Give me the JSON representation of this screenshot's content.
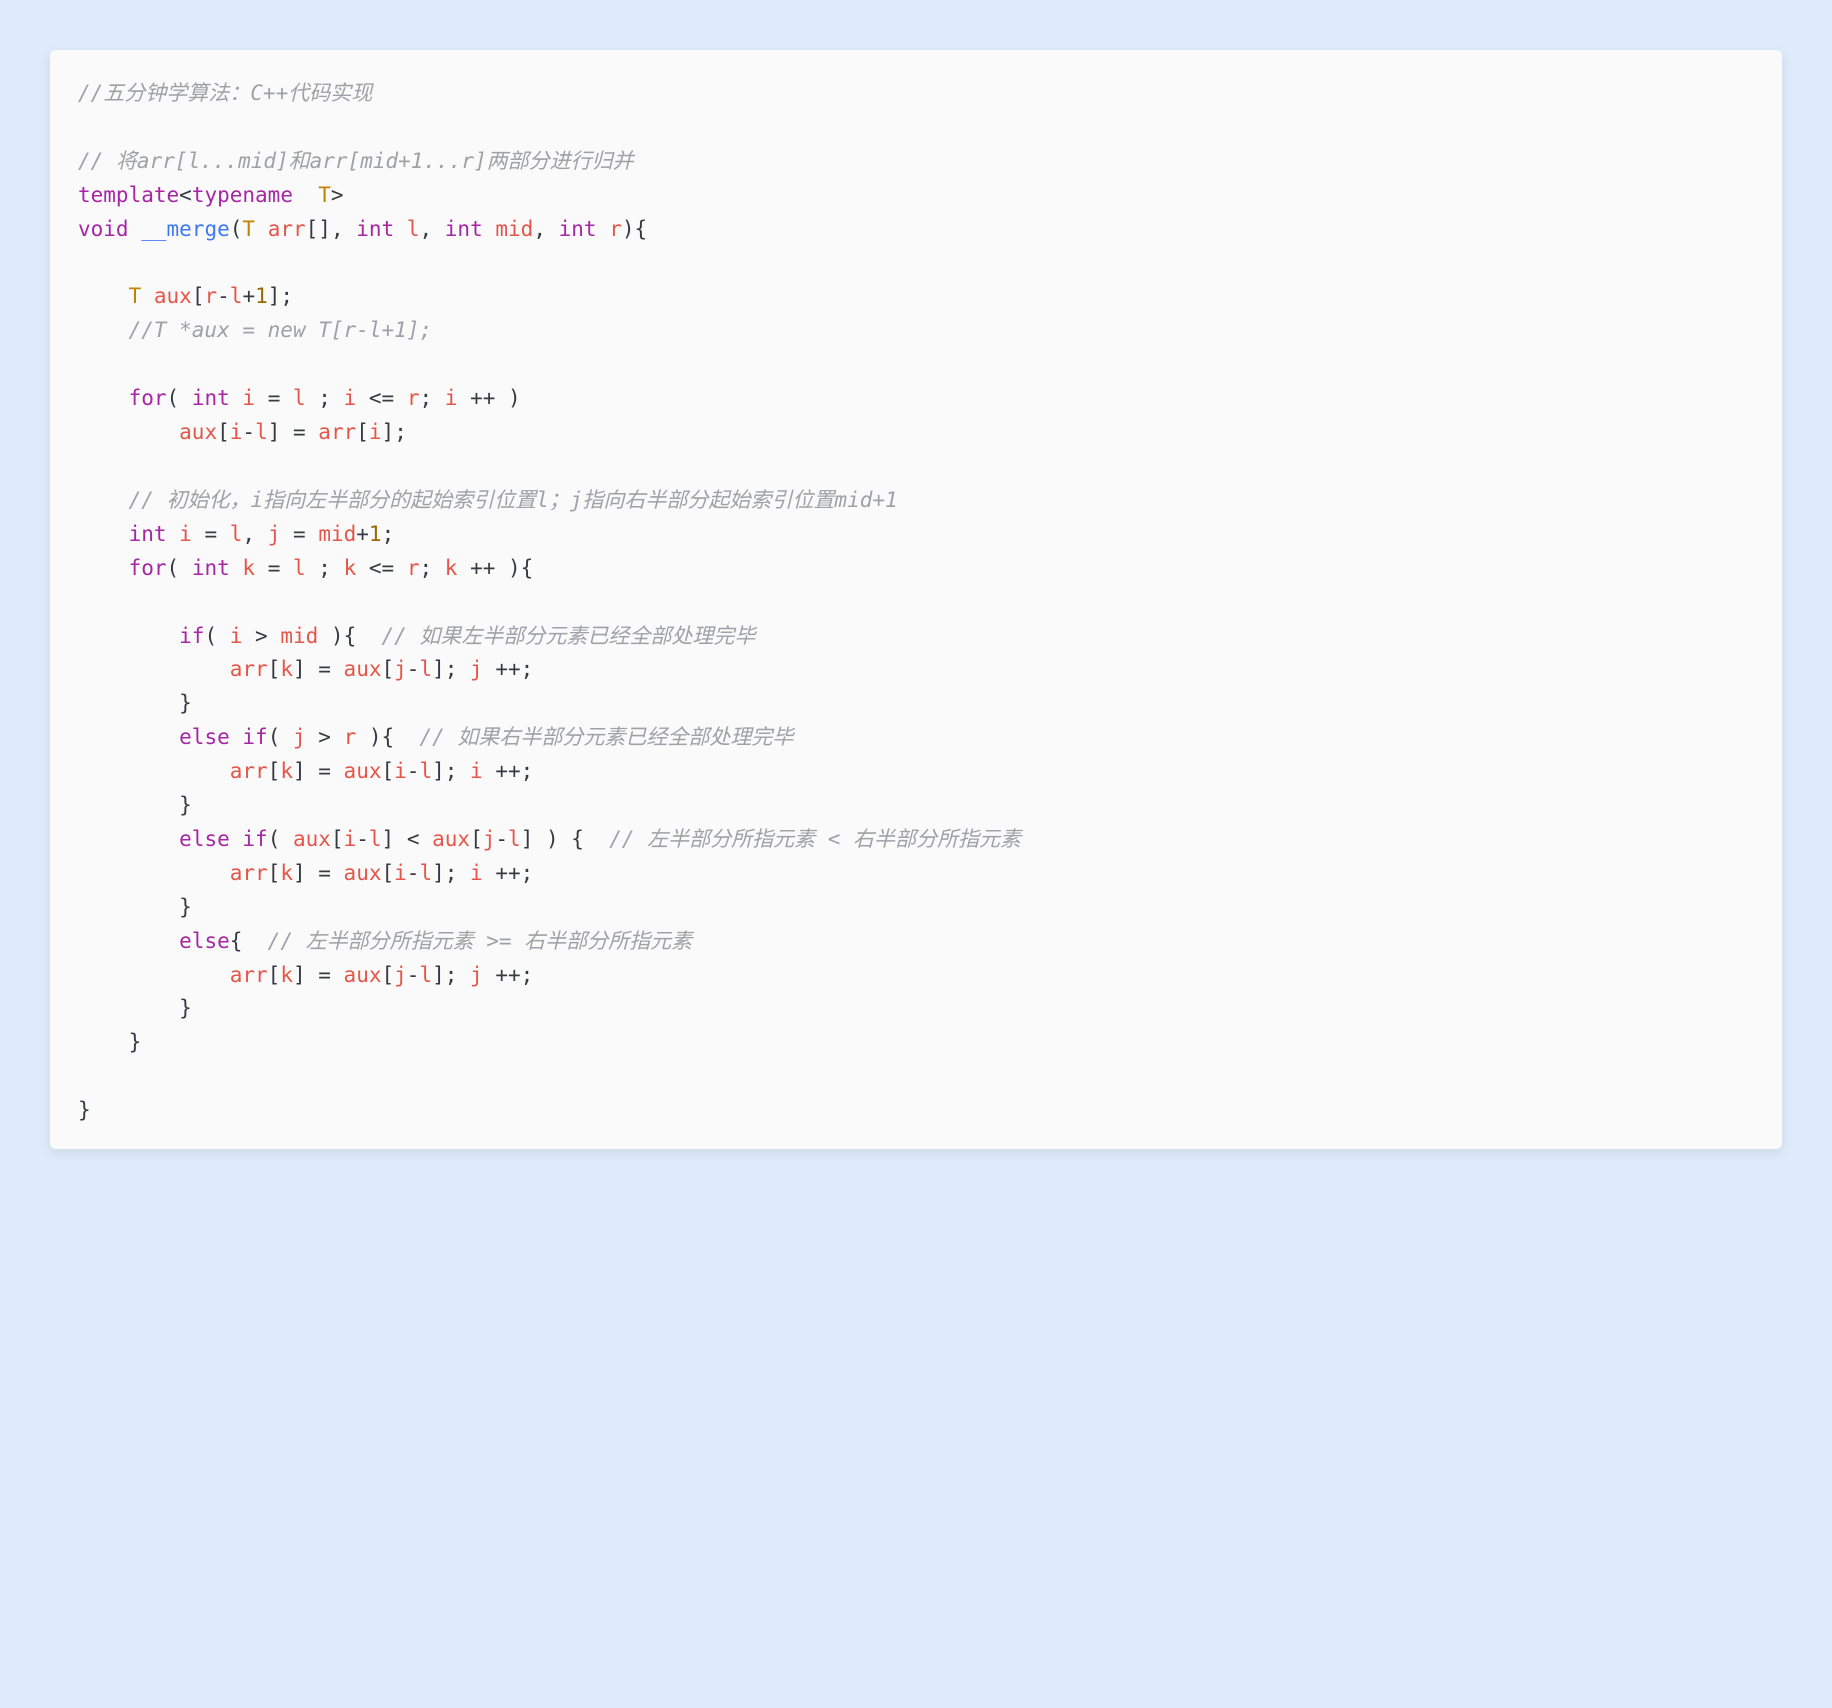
{
  "code": {
    "tokens": [
      [
        {
          "t": "//五分钟学算法：C++代码实现",
          "cls": "c"
        }
      ],
      [],
      [
        {
          "t": "// 将arr[l...mid]和arr[mid+1...r]两部分进行归并",
          "cls": "c"
        }
      ],
      [
        {
          "t": "template",
          "cls": "kw"
        },
        {
          "t": "<",
          "cls": "op"
        },
        {
          "t": "typename",
          "cls": "kw"
        },
        {
          "t": "  ",
          "cls": "pl"
        },
        {
          "t": "T",
          "cls": "ty"
        },
        {
          "t": ">",
          "cls": "op"
        }
      ],
      [
        {
          "t": "void",
          "cls": "kw"
        },
        {
          "t": " ",
          "cls": "pl"
        },
        {
          "t": "__merge",
          "cls": "fn"
        },
        {
          "t": "(",
          "cls": "pl"
        },
        {
          "t": "T",
          "cls": "ty"
        },
        {
          "t": " ",
          "cls": "pl"
        },
        {
          "t": "arr",
          "cls": "vr"
        },
        {
          "t": "[], ",
          "cls": "pl"
        },
        {
          "t": "int",
          "cls": "kw"
        },
        {
          "t": " ",
          "cls": "pl"
        },
        {
          "t": "l",
          "cls": "vr"
        },
        {
          "t": ", ",
          "cls": "pl"
        },
        {
          "t": "int",
          "cls": "kw"
        },
        {
          "t": " ",
          "cls": "pl"
        },
        {
          "t": "mid",
          "cls": "vr"
        },
        {
          "t": ", ",
          "cls": "pl"
        },
        {
          "t": "int",
          "cls": "kw"
        },
        {
          "t": " ",
          "cls": "pl"
        },
        {
          "t": "r",
          "cls": "vr"
        },
        {
          "t": "){",
          "cls": "pl"
        }
      ],
      [],
      [
        {
          "t": "    ",
          "cls": "pl"
        },
        {
          "t": "T",
          "cls": "ty"
        },
        {
          "t": " ",
          "cls": "pl"
        },
        {
          "t": "aux",
          "cls": "vr"
        },
        {
          "t": "[",
          "cls": "pl"
        },
        {
          "t": "r",
          "cls": "vr"
        },
        {
          "t": "-",
          "cls": "op"
        },
        {
          "t": "l",
          "cls": "vr"
        },
        {
          "t": "+",
          "cls": "op"
        },
        {
          "t": "1",
          "cls": "nm"
        },
        {
          "t": "];",
          "cls": "pl"
        }
      ],
      [
        {
          "t": "    ",
          "cls": "pl"
        },
        {
          "t": "//T *aux = new T[r-l+1];",
          "cls": "c"
        }
      ],
      [],
      [
        {
          "t": "    ",
          "cls": "pl"
        },
        {
          "t": "for",
          "cls": "kw"
        },
        {
          "t": "( ",
          "cls": "pl"
        },
        {
          "t": "int",
          "cls": "kw"
        },
        {
          "t": " ",
          "cls": "pl"
        },
        {
          "t": "i",
          "cls": "vr"
        },
        {
          "t": " = ",
          "cls": "op"
        },
        {
          "t": "l",
          "cls": "vr"
        },
        {
          "t": " ; ",
          "cls": "pl"
        },
        {
          "t": "i",
          "cls": "vr"
        },
        {
          "t": " <= ",
          "cls": "op"
        },
        {
          "t": "r",
          "cls": "vr"
        },
        {
          "t": "; ",
          "cls": "pl"
        },
        {
          "t": "i",
          "cls": "vr"
        },
        {
          "t": " ++ )",
          "cls": "pl"
        }
      ],
      [
        {
          "t": "        ",
          "cls": "pl"
        },
        {
          "t": "aux",
          "cls": "vr"
        },
        {
          "t": "[",
          "cls": "pl"
        },
        {
          "t": "i",
          "cls": "vr"
        },
        {
          "t": "-",
          "cls": "op"
        },
        {
          "t": "l",
          "cls": "vr"
        },
        {
          "t": "] = ",
          "cls": "pl"
        },
        {
          "t": "arr",
          "cls": "vr"
        },
        {
          "t": "[",
          "cls": "pl"
        },
        {
          "t": "i",
          "cls": "vr"
        },
        {
          "t": "];",
          "cls": "pl"
        }
      ],
      [],
      [
        {
          "t": "    ",
          "cls": "pl"
        },
        {
          "t": "// 初始化，i指向左半部分的起始索引位置l；j指向右半部分起始索引位置mid+1",
          "cls": "c"
        }
      ],
      [
        {
          "t": "    ",
          "cls": "pl"
        },
        {
          "t": "int",
          "cls": "kw"
        },
        {
          "t": " ",
          "cls": "pl"
        },
        {
          "t": "i",
          "cls": "vr"
        },
        {
          "t": " = ",
          "cls": "op"
        },
        {
          "t": "l",
          "cls": "vr"
        },
        {
          "t": ", ",
          "cls": "pl"
        },
        {
          "t": "j",
          "cls": "vr"
        },
        {
          "t": " = ",
          "cls": "op"
        },
        {
          "t": "mid",
          "cls": "vr"
        },
        {
          "t": "+",
          "cls": "op"
        },
        {
          "t": "1",
          "cls": "nm"
        },
        {
          "t": ";",
          "cls": "pl"
        }
      ],
      [
        {
          "t": "    ",
          "cls": "pl"
        },
        {
          "t": "for",
          "cls": "kw"
        },
        {
          "t": "( ",
          "cls": "pl"
        },
        {
          "t": "int",
          "cls": "kw"
        },
        {
          "t": " ",
          "cls": "pl"
        },
        {
          "t": "k",
          "cls": "vr"
        },
        {
          "t": " = ",
          "cls": "op"
        },
        {
          "t": "l",
          "cls": "vr"
        },
        {
          "t": " ; ",
          "cls": "pl"
        },
        {
          "t": "k",
          "cls": "vr"
        },
        {
          "t": " <= ",
          "cls": "op"
        },
        {
          "t": "r",
          "cls": "vr"
        },
        {
          "t": "; ",
          "cls": "pl"
        },
        {
          "t": "k",
          "cls": "vr"
        },
        {
          "t": " ++ ){",
          "cls": "pl"
        }
      ],
      [],
      [
        {
          "t": "        ",
          "cls": "pl"
        },
        {
          "t": "if",
          "cls": "kw"
        },
        {
          "t": "( ",
          "cls": "pl"
        },
        {
          "t": "i",
          "cls": "vr"
        },
        {
          "t": " > ",
          "cls": "op"
        },
        {
          "t": "mid",
          "cls": "vr"
        },
        {
          "t": " ){  ",
          "cls": "pl"
        },
        {
          "t": "// 如果左半部分元素已经全部处理完毕",
          "cls": "c"
        }
      ],
      [
        {
          "t": "            ",
          "cls": "pl"
        },
        {
          "t": "arr",
          "cls": "vr"
        },
        {
          "t": "[",
          "cls": "pl"
        },
        {
          "t": "k",
          "cls": "vr"
        },
        {
          "t": "] = ",
          "cls": "pl"
        },
        {
          "t": "aux",
          "cls": "vr"
        },
        {
          "t": "[",
          "cls": "pl"
        },
        {
          "t": "j",
          "cls": "vr"
        },
        {
          "t": "-",
          "cls": "op"
        },
        {
          "t": "l",
          "cls": "vr"
        },
        {
          "t": "]; ",
          "cls": "pl"
        },
        {
          "t": "j",
          "cls": "vr"
        },
        {
          "t": " ++;",
          "cls": "pl"
        }
      ],
      [
        {
          "t": "        }",
          "cls": "pl"
        }
      ],
      [
        {
          "t": "        ",
          "cls": "pl"
        },
        {
          "t": "else",
          "cls": "kw"
        },
        {
          "t": " ",
          "cls": "pl"
        },
        {
          "t": "if",
          "cls": "kw"
        },
        {
          "t": "( ",
          "cls": "pl"
        },
        {
          "t": "j",
          "cls": "vr"
        },
        {
          "t": " > ",
          "cls": "op"
        },
        {
          "t": "r",
          "cls": "vr"
        },
        {
          "t": " ){  ",
          "cls": "pl"
        },
        {
          "t": "// 如果右半部分元素已经全部处理完毕",
          "cls": "c"
        }
      ],
      [
        {
          "t": "            ",
          "cls": "pl"
        },
        {
          "t": "arr",
          "cls": "vr"
        },
        {
          "t": "[",
          "cls": "pl"
        },
        {
          "t": "k",
          "cls": "vr"
        },
        {
          "t": "] = ",
          "cls": "pl"
        },
        {
          "t": "aux",
          "cls": "vr"
        },
        {
          "t": "[",
          "cls": "pl"
        },
        {
          "t": "i",
          "cls": "vr"
        },
        {
          "t": "-",
          "cls": "op"
        },
        {
          "t": "l",
          "cls": "vr"
        },
        {
          "t": "]; ",
          "cls": "pl"
        },
        {
          "t": "i",
          "cls": "vr"
        },
        {
          "t": " ++;",
          "cls": "pl"
        }
      ],
      [
        {
          "t": "        }",
          "cls": "pl"
        }
      ],
      [
        {
          "t": "        ",
          "cls": "pl"
        },
        {
          "t": "else",
          "cls": "kw"
        },
        {
          "t": " ",
          "cls": "pl"
        },
        {
          "t": "if",
          "cls": "kw"
        },
        {
          "t": "( ",
          "cls": "pl"
        },
        {
          "t": "aux",
          "cls": "vr"
        },
        {
          "t": "[",
          "cls": "pl"
        },
        {
          "t": "i",
          "cls": "vr"
        },
        {
          "t": "-",
          "cls": "op"
        },
        {
          "t": "l",
          "cls": "vr"
        },
        {
          "t": "] < ",
          "cls": "pl"
        },
        {
          "t": "aux",
          "cls": "vr"
        },
        {
          "t": "[",
          "cls": "pl"
        },
        {
          "t": "j",
          "cls": "vr"
        },
        {
          "t": "-",
          "cls": "op"
        },
        {
          "t": "l",
          "cls": "vr"
        },
        {
          "t": "] ) {  ",
          "cls": "pl"
        },
        {
          "t": "// 左半部分所指元素 < 右半部分所指元素",
          "cls": "c"
        }
      ],
      [
        {
          "t": "            ",
          "cls": "pl"
        },
        {
          "t": "arr",
          "cls": "vr"
        },
        {
          "t": "[",
          "cls": "pl"
        },
        {
          "t": "k",
          "cls": "vr"
        },
        {
          "t": "] = ",
          "cls": "pl"
        },
        {
          "t": "aux",
          "cls": "vr"
        },
        {
          "t": "[",
          "cls": "pl"
        },
        {
          "t": "i",
          "cls": "vr"
        },
        {
          "t": "-",
          "cls": "op"
        },
        {
          "t": "l",
          "cls": "vr"
        },
        {
          "t": "]; ",
          "cls": "pl"
        },
        {
          "t": "i",
          "cls": "vr"
        },
        {
          "t": " ++;",
          "cls": "pl"
        }
      ],
      [
        {
          "t": "        }",
          "cls": "pl"
        }
      ],
      [
        {
          "t": "        ",
          "cls": "pl"
        },
        {
          "t": "else",
          "cls": "kw"
        },
        {
          "t": "{  ",
          "cls": "pl"
        },
        {
          "t": "// 左半部分所指元素 >= 右半部分所指元素",
          "cls": "c"
        }
      ],
      [
        {
          "t": "            ",
          "cls": "pl"
        },
        {
          "t": "arr",
          "cls": "vr"
        },
        {
          "t": "[",
          "cls": "pl"
        },
        {
          "t": "k",
          "cls": "vr"
        },
        {
          "t": "] = ",
          "cls": "pl"
        },
        {
          "t": "aux",
          "cls": "vr"
        },
        {
          "t": "[",
          "cls": "pl"
        },
        {
          "t": "j",
          "cls": "vr"
        },
        {
          "t": "-",
          "cls": "op"
        },
        {
          "t": "l",
          "cls": "vr"
        },
        {
          "t": "]; ",
          "cls": "pl"
        },
        {
          "t": "j",
          "cls": "vr"
        },
        {
          "t": " ++;",
          "cls": "pl"
        }
      ],
      [
        {
          "t": "        }",
          "cls": "pl"
        }
      ],
      [
        {
          "t": "    }",
          "cls": "pl"
        }
      ],
      [],
      [
        {
          "t": "}",
          "cls": "pl"
        }
      ]
    ]
  }
}
